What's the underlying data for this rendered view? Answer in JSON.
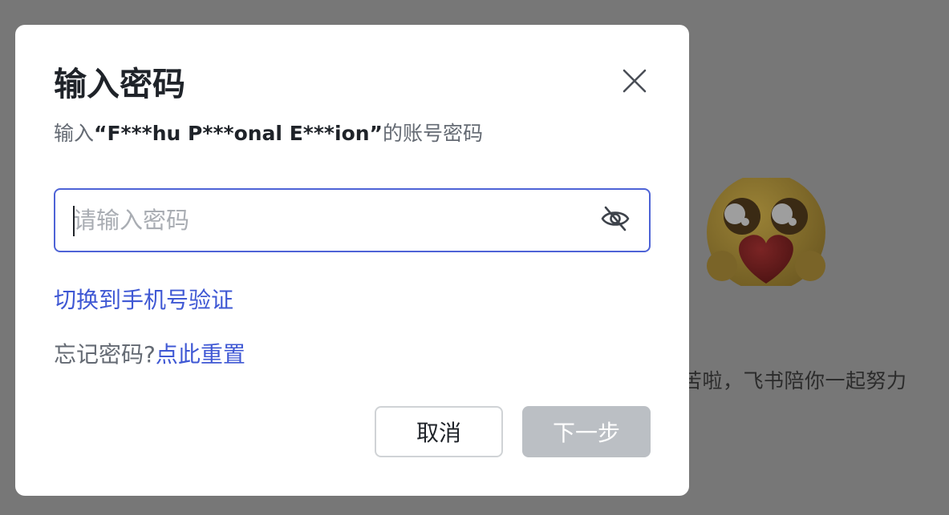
{
  "background": {
    "slogan": "苦啦，飞书陪你一起努力",
    "emoji_icon": "heart-hug-emoji-icon"
  },
  "dialog": {
    "title": "输入密码",
    "subtitle_prefix": "输入",
    "account_name": "“F***hu P***onal E***ion”",
    "subtitle_suffix": "的账号密码",
    "close_icon": "close-icon",
    "password": {
      "value": "",
      "placeholder": "请输入密码",
      "visibility_icon": "eye-off-icon"
    },
    "switch_link": "切换到手机号验证",
    "forgot_text": "忘记密码?",
    "reset_link": "点此重置",
    "cancel_label": "取消",
    "next_label": "下一步"
  },
  "colors": {
    "accent": "#3f58d4",
    "input_border": "#4e63d6",
    "disabled_button": "#bbbfc4",
    "overlay": "#777777"
  }
}
